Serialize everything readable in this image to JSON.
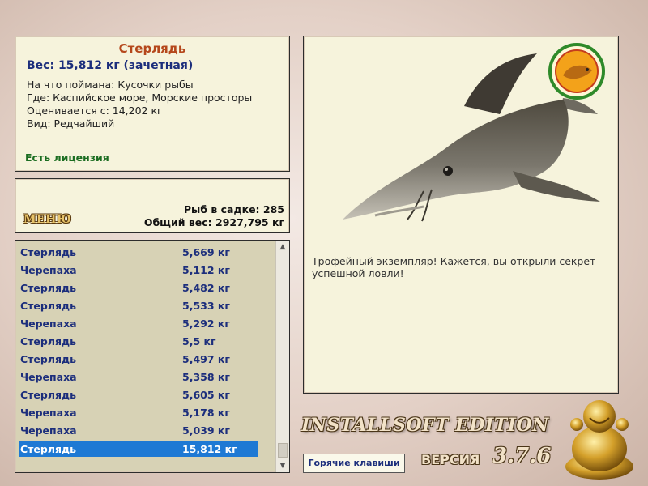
{
  "fish_info": {
    "name": "Стерлядь",
    "weight": "Вес: 15,812 кг (зачетная)",
    "bait": "На что поймана: Кусочки рыбы",
    "location": "Где: Каспийское море, Морские просторы",
    "valued_from": "Оценивается с: 14,202 кг",
    "type": "Вид: Редчайший",
    "license": "Есть лицензия"
  },
  "stats": {
    "menu_label": "МЕНЮ",
    "fish_count": "Рыб в садке: 285",
    "total_weight": "Общий вес: 2927,795 кг"
  },
  "catch_list": [
    {
      "name": "Стерлядь",
      "weight": "5,669 кг"
    },
    {
      "name": "Черепаха",
      "weight": "5,112 кг"
    },
    {
      "name": "Стерлядь",
      "weight": "5,482 кг"
    },
    {
      "name": "Стерлядь",
      "weight": "5,533 кг"
    },
    {
      "name": "Черепаха",
      "weight": "5,292 кг"
    },
    {
      "name": "Стерлядь",
      "weight": "5,5 кг"
    },
    {
      "name": "Стерлядь",
      "weight": "5,497 кг"
    },
    {
      "name": "Черепаха",
      "weight": "5,358 кг"
    },
    {
      "name": "Стерлядь",
      "weight": "5,605 кг"
    },
    {
      "name": "Черепаха",
      "weight": "5,178 кг"
    },
    {
      "name": "Черепаха",
      "weight": "5,039 кг"
    },
    {
      "name": "Стерлядь",
      "weight": "15,812 кг",
      "selected": true
    }
  ],
  "photo_panel": {
    "message": "Трофейный экземпляр! Кажется, вы открыли секрет успешной ловли!",
    "image": "sterlet-fish-image",
    "emblem": "fishing-emblem-icon"
  },
  "footer": {
    "brand": "INSTALLSOFT EDITION",
    "hotkeys_label": "Горячие клавиши",
    "version_label": "ВЕРСИЯ",
    "version_number": "3.7.6",
    "mascot": "buddha-statue-image"
  },
  "colors": {
    "panel_bg": "#f6f3dc",
    "title_orange": "#b5471b",
    "text_blue": "#1c2e7c",
    "license_green": "#1b6d21",
    "selection_blue": "#1e79d4",
    "list_bg": "#d7d2b5"
  }
}
